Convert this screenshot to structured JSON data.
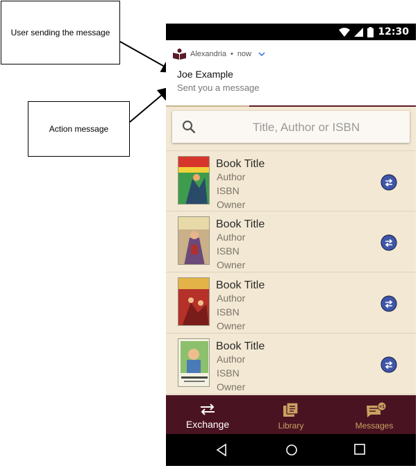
{
  "annotations": {
    "sender_callout": "User sending the message",
    "action_callout": "Action message"
  },
  "status_bar": {
    "time": "12:30"
  },
  "notification": {
    "app_name": "Alexandria",
    "dot": "•",
    "when": "now",
    "sender": "Joe Example",
    "message": "Sent you a message"
  },
  "search": {
    "placeholder": "Title, Author or ISBN"
  },
  "books": [
    {
      "title": "Book Title",
      "author": "Author",
      "isbn": "ISBN",
      "owner": "Owner"
    },
    {
      "title": "Book Title",
      "author": "Author",
      "isbn": "ISBN",
      "owner": "Owner"
    },
    {
      "title": "Book Title",
      "author": "Author",
      "isbn": "ISBN",
      "owner": "Owner"
    },
    {
      "title": "Book Title",
      "author": "Author",
      "isbn": "ISBN",
      "owner": "Owner"
    }
  ],
  "bottom_nav": {
    "exchange": "Exchange",
    "library": "Library",
    "messages": "Messages",
    "messages_badge": "+1"
  },
  "colors": {
    "brand": "#4a1322",
    "background": "#f3e8d3",
    "accent": "#c9a262",
    "exchange_button": "#3f56a8"
  }
}
